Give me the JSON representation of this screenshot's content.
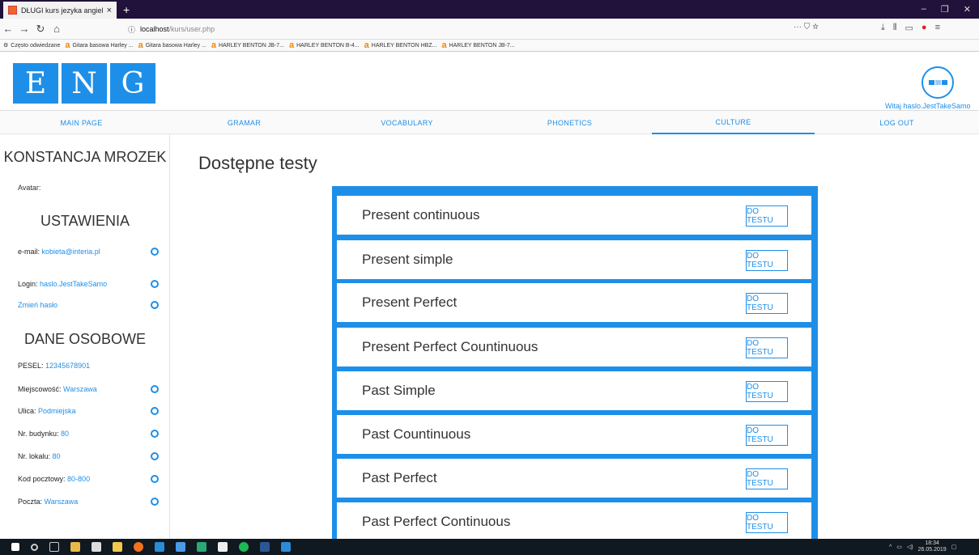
{
  "browser": {
    "tab_title": "DŁUGI kurs jezyka angielskiego",
    "tab_close": "×",
    "new_tab": "+",
    "url_host": "localhost",
    "url_path": "/kurs/user.php",
    "url_actions": "··· ⛉ ☆",
    "bookmarks": [
      "Często odwiedzane",
      "Gitara basowa Harley ...",
      "Gitara basowa Harley ...",
      "HARLEY BENTON JB-7...",
      "HARLEY BENTON B-4...",
      "HARLEY BENTON HBZ...",
      "HARLEY BENTON JB-7..."
    ]
  },
  "header": {
    "logo_letters": [
      "E",
      "N",
      "G"
    ],
    "welcome": "Witaj haslo.JestTakeSamo"
  },
  "menu": [
    "MAIN PAGE",
    "GRAMAR",
    "VOCABULARY",
    "PHONETICS",
    "CULTURE",
    "LOG OUT"
  ],
  "sidebar": {
    "user_name": "KONSTANCJA MROZEK",
    "avatar_label": "Avatar:",
    "settings_title": "USTAWIENIA",
    "email_label": "e-mail:",
    "email_value": "kobieta@interia.pl",
    "login_label": "Login:",
    "login_value": "haslo.JestTakeSamo",
    "change_password": "Zmień hasło",
    "personal_title": "DANE OSOBOWE",
    "pesel_label": "PESEL:",
    "pesel_value": "12345678901",
    "city_label": "Miejscowość:",
    "city_value": "Warszawa",
    "street_label": "Ulica:",
    "street_value": "Podmiejska",
    "building_label": "Nr. budynku:",
    "building_value": "80",
    "flat_label": "Nr. lokalu:",
    "flat_value": "80",
    "postcode_label": "Kod pocztowy:",
    "postcode_value": "80-800",
    "post_label": "Poczta:",
    "post_value": "Warszawa"
  },
  "main": {
    "title": "Dostępne testy",
    "button_label": "DO TESTU",
    "tests": [
      "Present continuous",
      "Present simple",
      "Present Perfect",
      "Present Perfect Countinuous",
      "Past Simple",
      "Past Countinuous",
      "Past Perfect",
      "Past Perfect Continuous"
    ]
  },
  "taskbar": {
    "time": "18:34",
    "date": "26.05.2019"
  },
  "colors": {
    "accent": "#1e8fe8"
  }
}
